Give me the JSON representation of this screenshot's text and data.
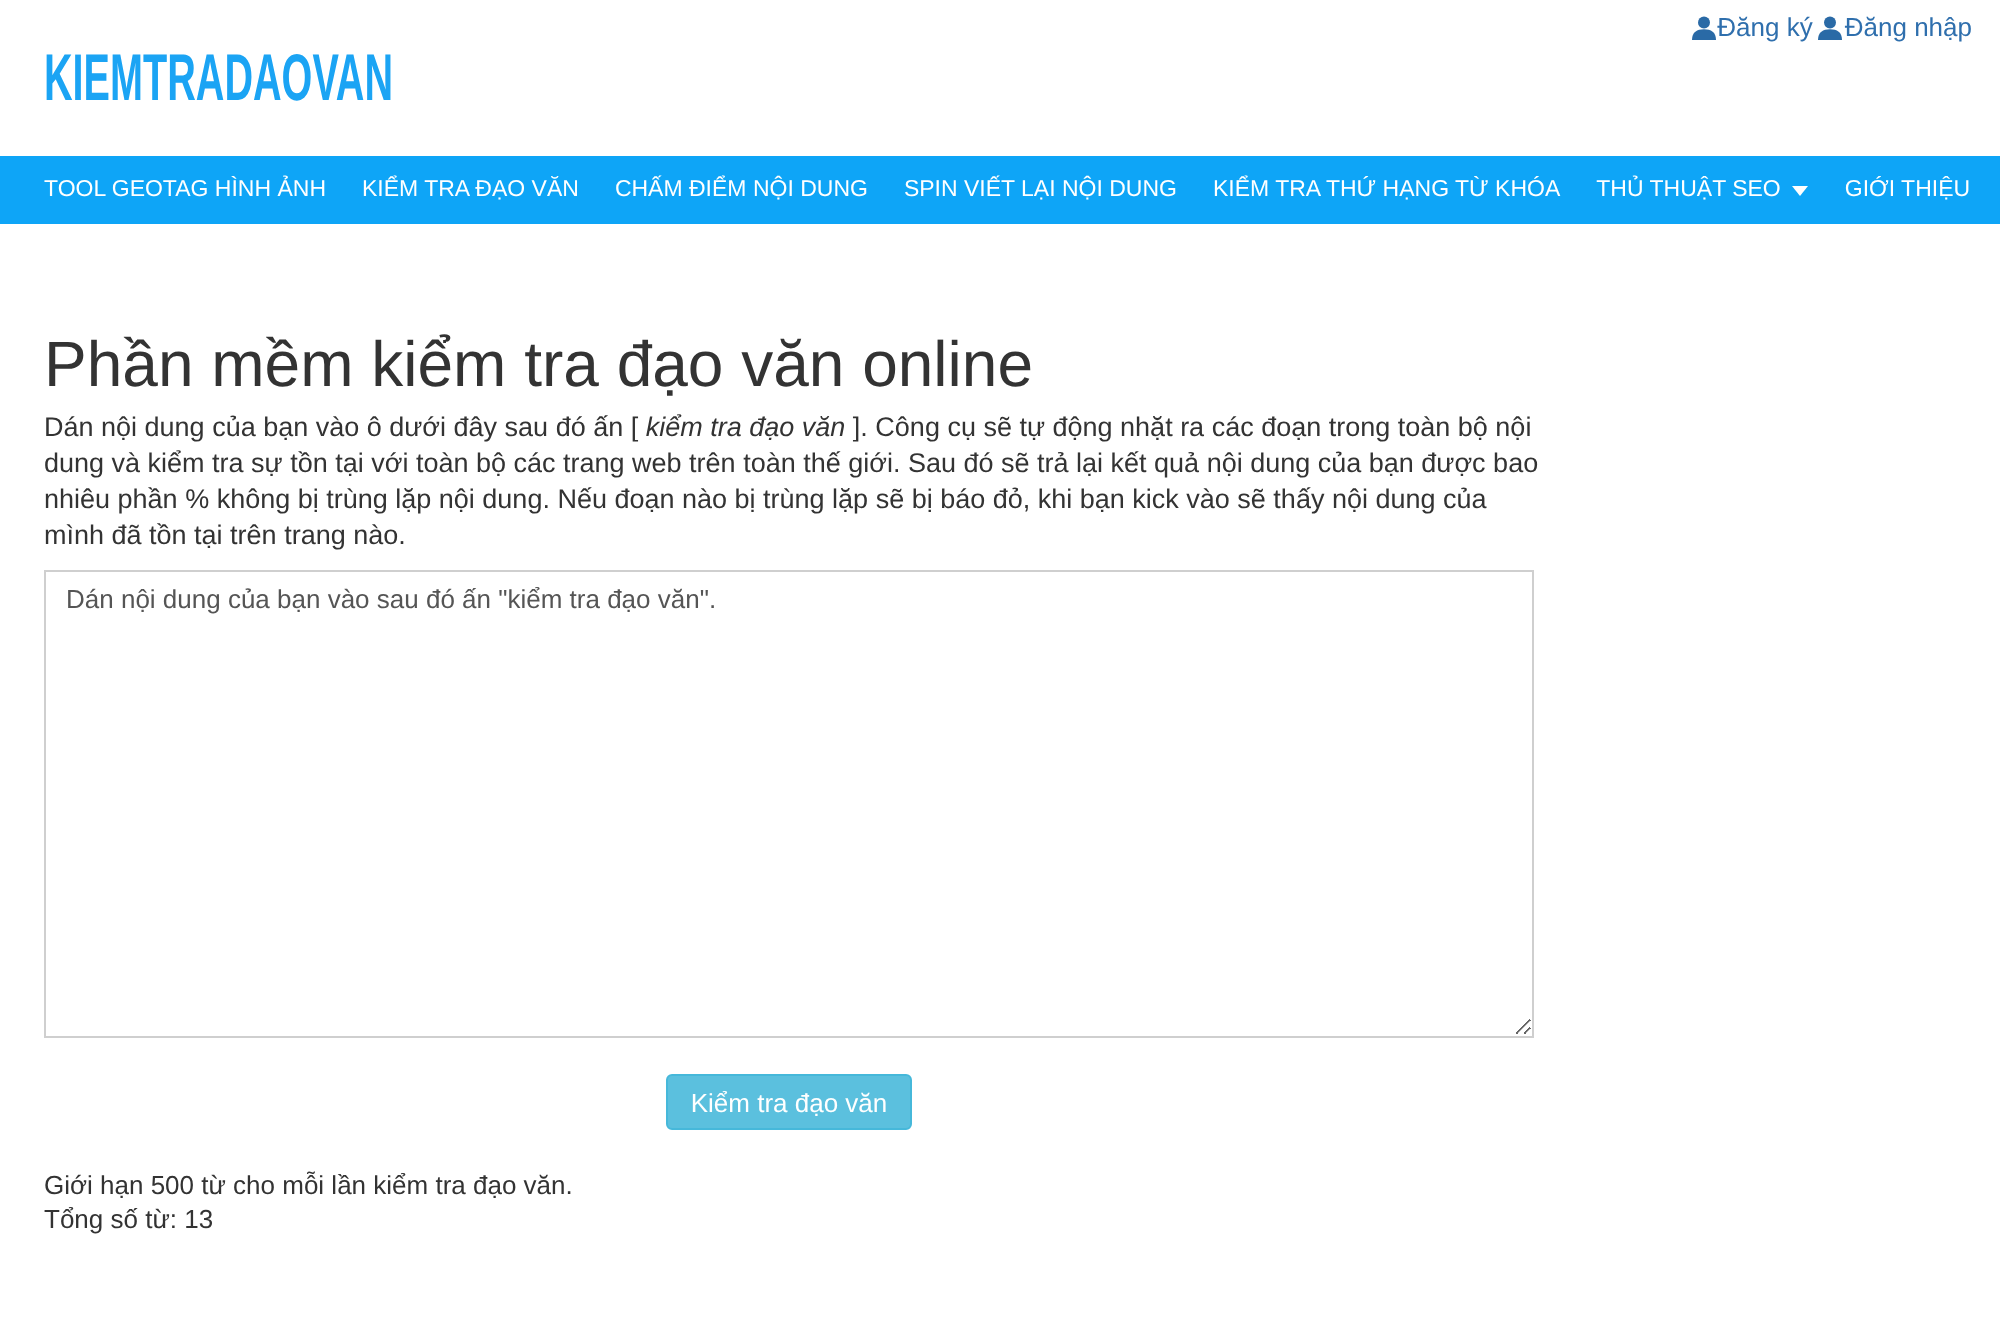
{
  "header": {
    "logo": "KIEMTRADAOVAN",
    "account_links": [
      {
        "label": "Đăng ký"
      },
      {
        "label": "Đăng nhập"
      }
    ]
  },
  "nav": {
    "items": [
      {
        "label": "TOOL GEOTAG HÌNH ẢNH",
        "kind": "link"
      },
      {
        "label": "KIỂM TRA ĐẠO VĂN",
        "kind": "link"
      },
      {
        "label": "CHẤM ĐIỂM NỘI DUNG",
        "kind": "link"
      },
      {
        "label": "SPIN VIẾT LẠI NỘI DUNG",
        "kind": "link"
      },
      {
        "label": "KIỂM TRA THỨ HẠNG TỪ KHÓA",
        "kind": "link"
      },
      {
        "label": "THỦ THUẬT SEO",
        "kind": "dropdown"
      },
      {
        "label": "GIỚI THIỆU",
        "kind": "link"
      }
    ]
  },
  "main": {
    "title": "Phần mềm kiểm tra đạo văn online",
    "description": "Dán nội dung của bạn vào ô dưới đây sau đó ấn [ *kiểm tra đạo văn* ]. Công cụ sẽ tự động nhặt ra các đoạn trong toàn bộ nội dung và kiểm tra sự tồn tại với toàn bộ các trang web trên toàn thế giới. Sau đó sẽ trả lại kết quả nội dung của bạn được bao nhiêu phần % không bị trùng lặp nội dung. Nếu đoạn nào bị trùng lặp sẽ bị báo đỏ, khi bạn kick vào sẽ thấy nội dung của mình đã tồn tại trên trang nào.",
    "editor": {
      "value": "Dán nội dung của bạn vào sau đó ấn \"kiểm tra đạo văn\"."
    },
    "submit_button": "Kiểm tra đạo văn",
    "limit_note": "Giới hạn 500 từ cho mỗi lần kiểm tra đạo văn.",
    "word_count": "Tổng số từ: 13"
  }
}
